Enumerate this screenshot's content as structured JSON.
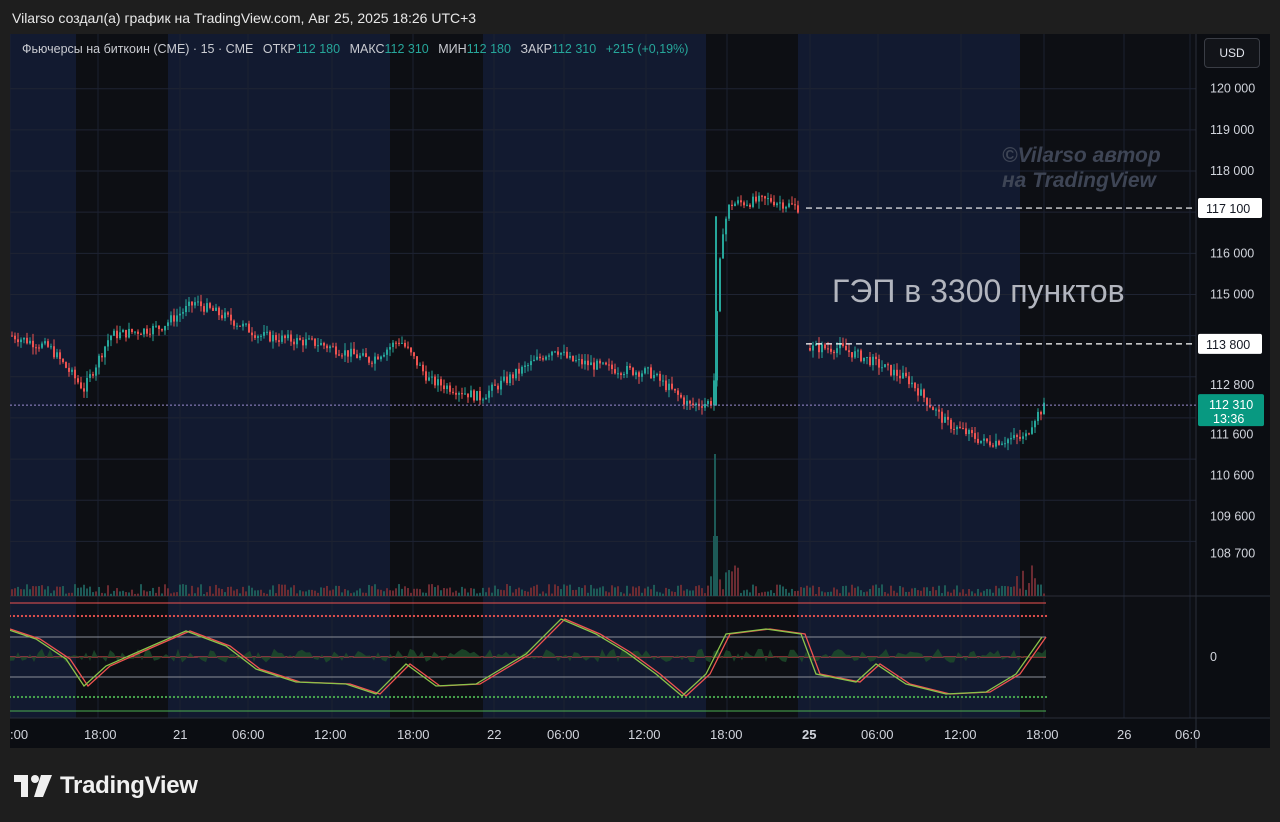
{
  "header": {
    "caption": "Vilarso создал(а) график на TradingView.com, Авг 25, 2025 18:26 UTC+3"
  },
  "legend": {
    "symbol": "Фьючерсы на биткоин (CME) · 15 · CME",
    "open_label": "ОТКР",
    "open_value": "112 180",
    "high_label": "МАКС",
    "high_value": "112 310",
    "low_label": "МИН",
    "low_value": "112 180",
    "close_label": "ЗАКР",
    "close_value": "112 310",
    "change": "+215 (+0,19%)"
  },
  "currency_button": "USD",
  "price_axis": {
    "ticks": [
      "120 000",
      "119 000",
      "118 000",
      "117 100",
      "116 000",
      "115 000",
      "113 800",
      "112 800",
      "112 310",
      "111 600",
      "110 600",
      "109 600",
      "108 700"
    ],
    "current_price": "112 310",
    "countdown": "13:36",
    "gap_top_label": "117 100",
    "gap_bottom_label": "113 800"
  },
  "oscillator_axis": {
    "zero_label": "0"
  },
  "time_axis": {
    "ticks": [
      ":00",
      "18:00",
      "21",
      "06:00",
      "12:00",
      "18:00",
      "22",
      "06:00",
      "12:00",
      "18:00",
      "25",
      "06:00",
      "12:00",
      "18:00",
      "26",
      "06:0"
    ]
  },
  "annotations": {
    "gap_text": "ГЭП в 3300  пунктов",
    "watermark_line1": "©Vilarso автор",
    "watermark_line2": "на TradingView"
  },
  "colors": {
    "up": "#26a69a",
    "down": "#ef5350",
    "accent": "#089981",
    "session": "#121a30"
  },
  "footer": {
    "brand": "TradingView",
    "logo_icon": "tradingview-logo-icon"
  },
  "chart_data": {
    "type": "candlestick",
    "series": [
      {
        "name": "price",
        "x": [
          ":00",
          "18:00",
          "21",
          "06:00",
          "12:00",
          "18:00",
          "22",
          "06:00",
          "12:00",
          "18:00",
          "25",
          "06:00",
          "12:00",
          "18:00"
        ],
        "values": [
          114000,
          114000,
          114700,
          114000,
          113500,
          113800,
          112400,
          113500,
          112900,
          117100,
          117100,
          113700,
          111400,
          112310
        ]
      }
    ],
    "ylim": [
      108500,
      120500
    ],
    "gap_levels": [
      117100,
      113800
    ],
    "current_price": 112310
  }
}
